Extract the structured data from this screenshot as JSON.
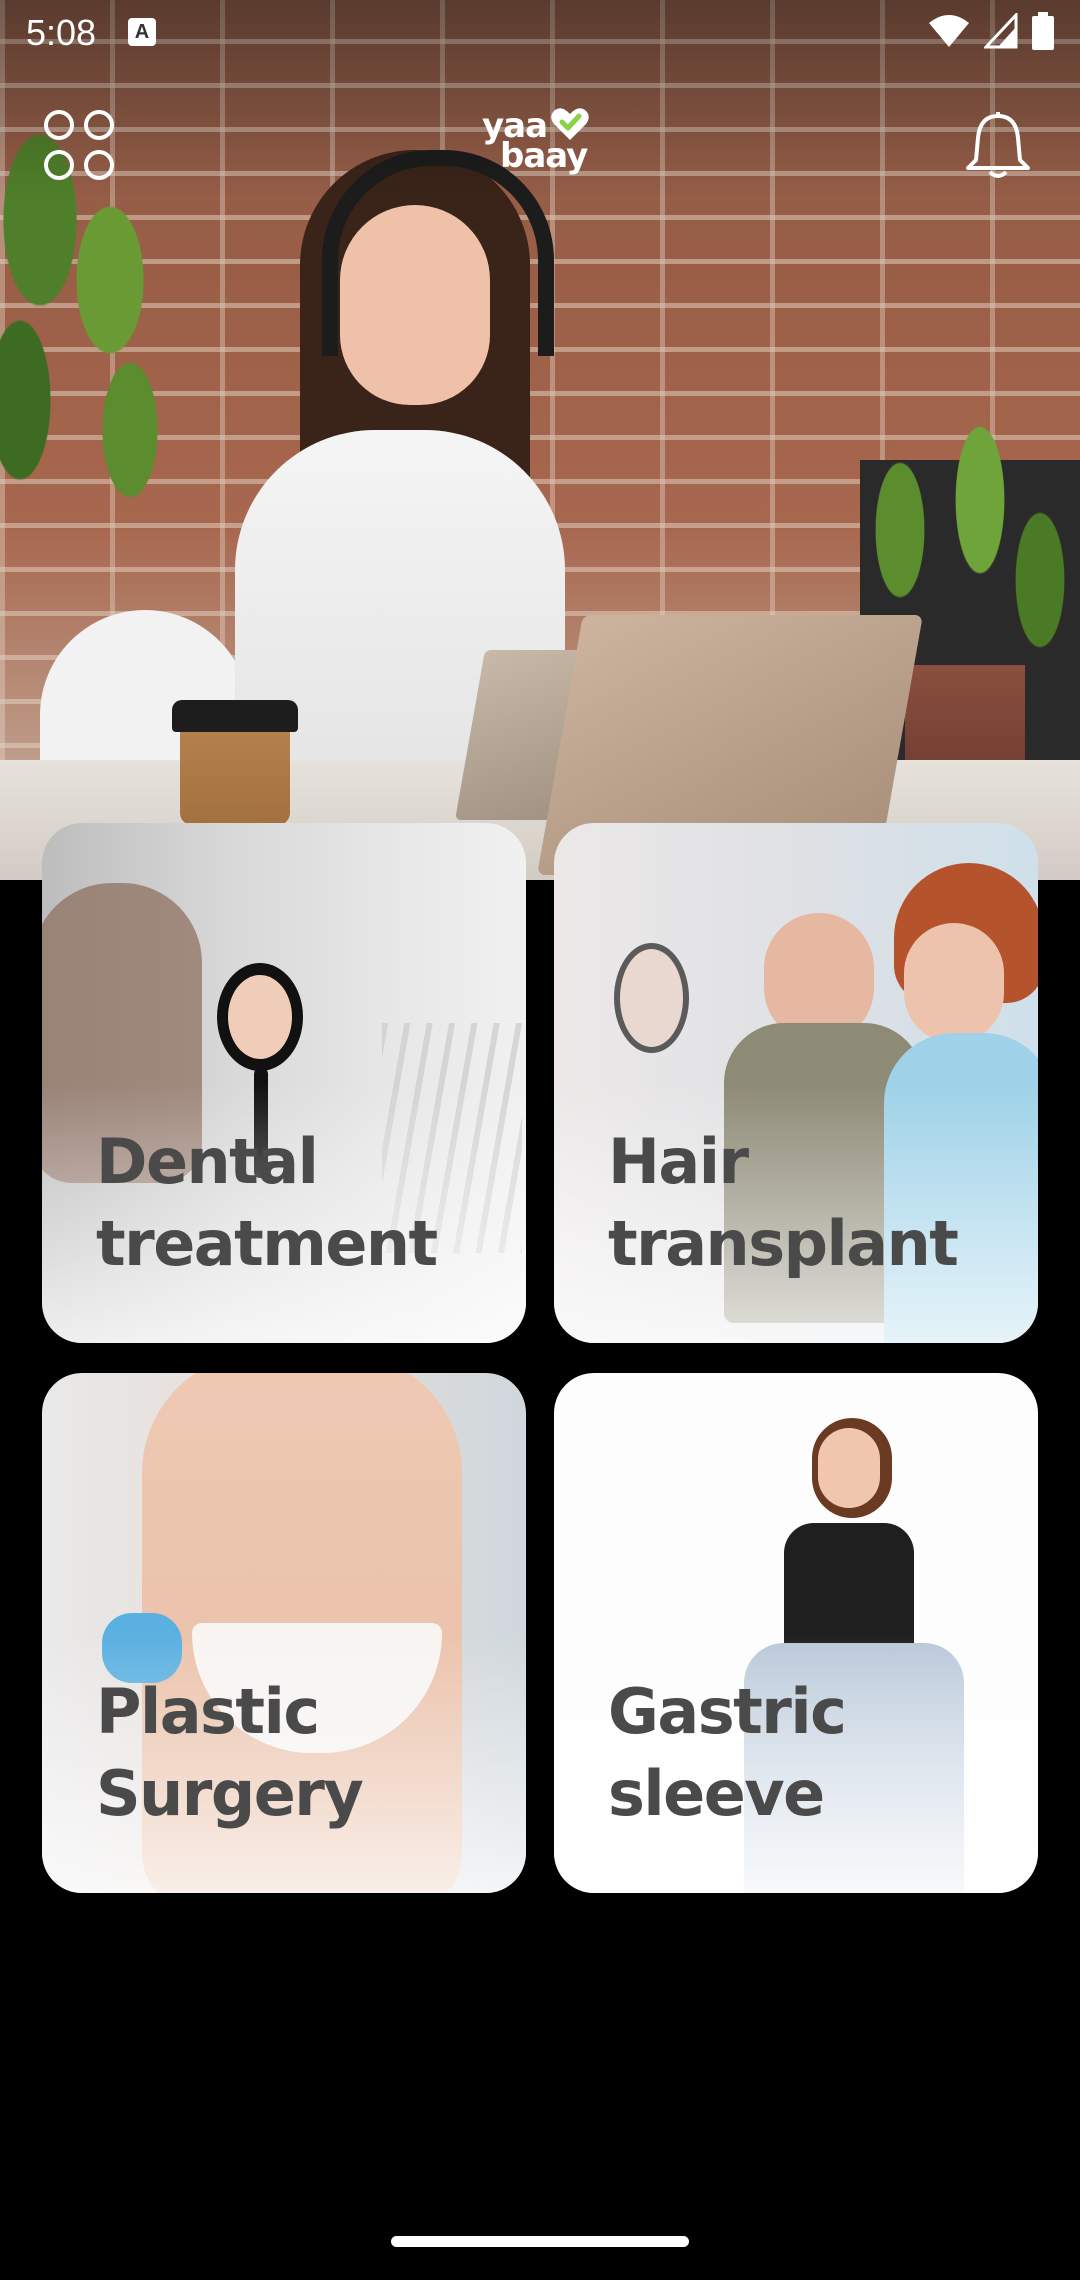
{
  "status_bar": {
    "time": "5:08",
    "notification_glyph": "A"
  },
  "header": {
    "logo_line1": "yaa",
    "logo_line2": "baay",
    "menu_icon": "grid-circles-icon",
    "bell_icon": "bell-icon"
  },
  "cards": [
    {
      "label": "Dental\ntreatment",
      "icon": "dental-image"
    },
    {
      "label": "Hair\ntransplant",
      "icon": "hair-image"
    },
    {
      "label": "Plastic\nSurgery",
      "icon": "plastic-image"
    },
    {
      "label": "Gastric\nsleeve",
      "icon": "gastric-image"
    }
  ],
  "colors": {
    "background": "#000000",
    "card_text": "#4a4a4a",
    "brand_accent": "#8ad146"
  }
}
